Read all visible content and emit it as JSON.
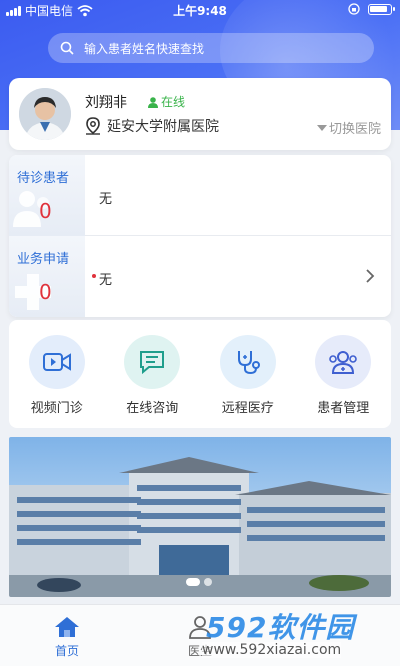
{
  "status_bar": {
    "carrier": "中国电信",
    "time": "上午9:48"
  },
  "search": {
    "placeholder": "输入患者姓名快速查找"
  },
  "profile": {
    "name": "刘翔非",
    "status": "在线",
    "hospital": "延安大学附属医院",
    "switch_label": "切换医院"
  },
  "tasks": [
    {
      "title": "待诊患者",
      "count": "0",
      "text": "无"
    },
    {
      "title": "业务申请",
      "count": "0",
      "text": "无"
    }
  ],
  "menu": [
    {
      "label": "视频门诊",
      "icon": "video-camera-icon"
    },
    {
      "label": "在线咨询",
      "icon": "chat-icon"
    },
    {
      "label": "远程医疗",
      "icon": "stethoscope-icon"
    },
    {
      "label": "患者管理",
      "icon": "patients-group-icon"
    }
  ],
  "banner": {
    "slides": 2,
    "active_slide": 1
  },
  "tabbar": {
    "home": "首页",
    "doctor": "医生"
  },
  "watermark": {
    "brand": "592软件园",
    "url": "www.592xiazai.com"
  },
  "colors": {
    "primary": "#3b5bf0",
    "accent_blue": "#2f6fd6",
    "online_green": "#39b34a",
    "alert_red": "#e0323c"
  }
}
